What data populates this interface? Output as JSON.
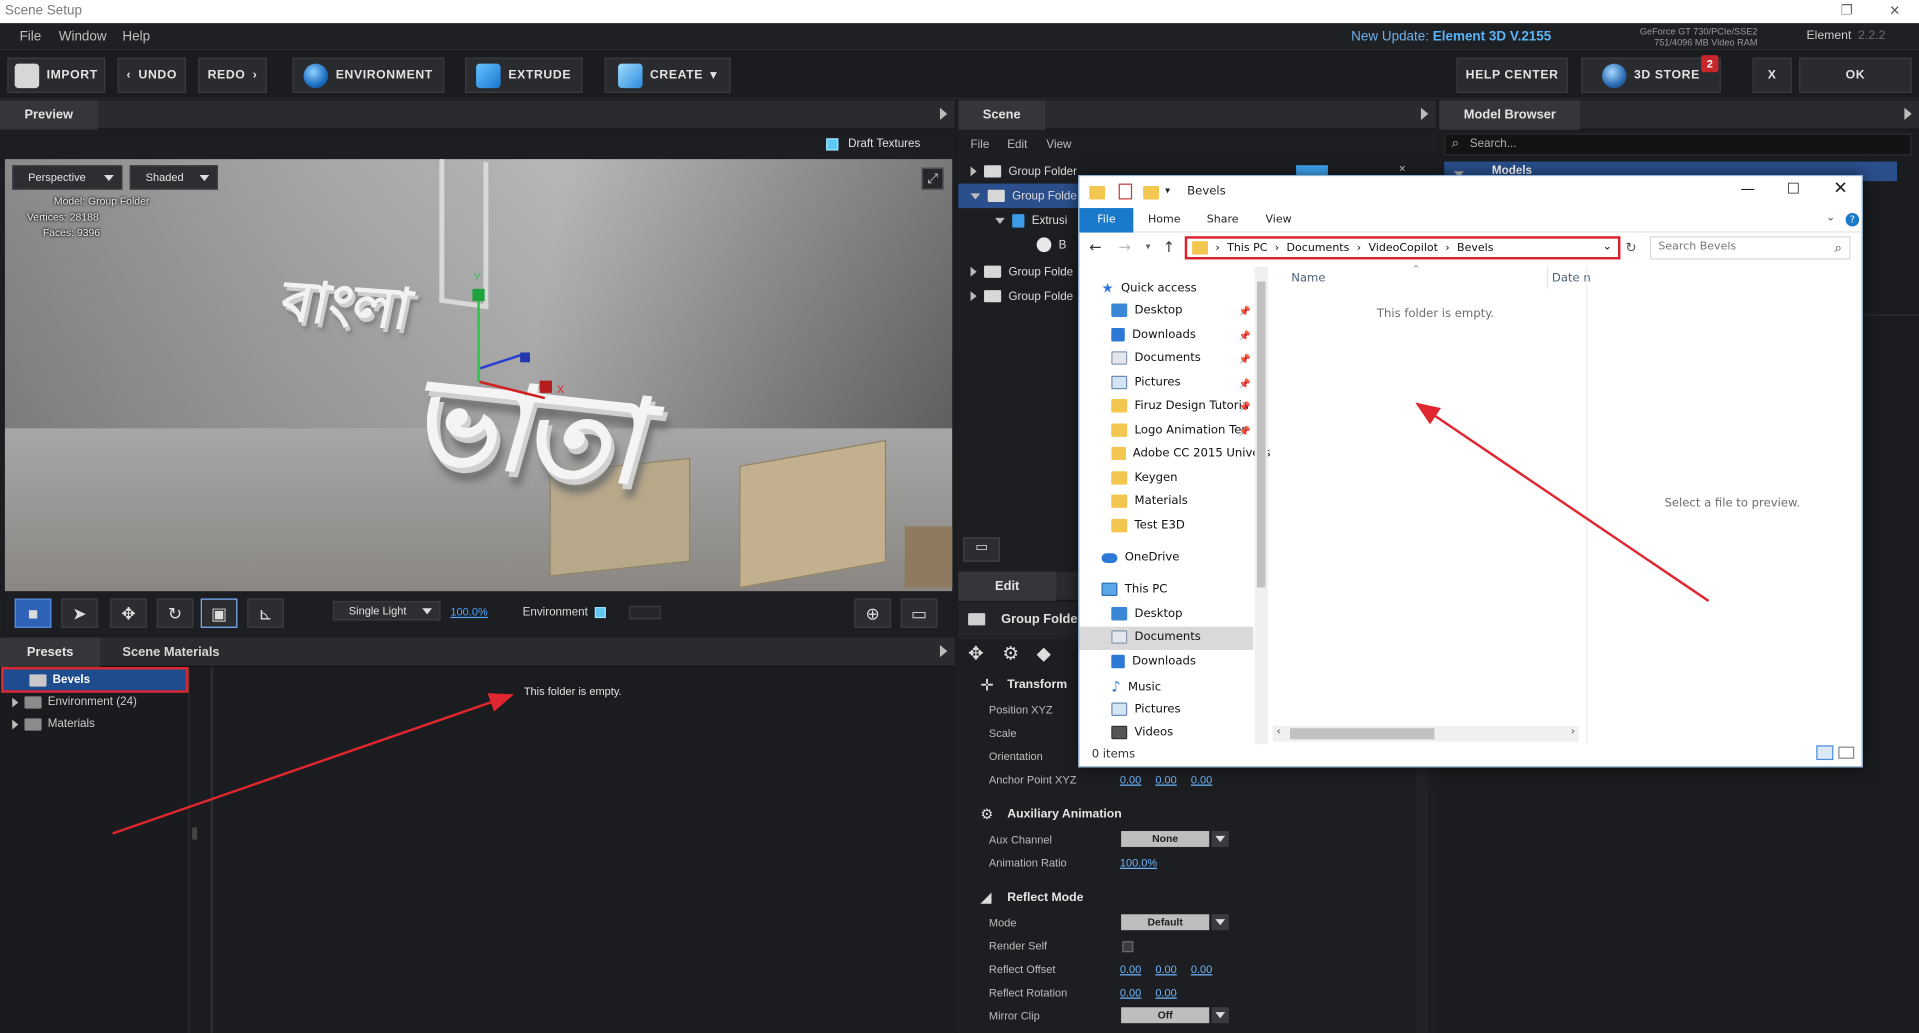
{
  "window": {
    "title": "Scene Setup"
  },
  "menu": [
    "File",
    "Window",
    "Help"
  ],
  "update": {
    "prefix": "New Update: ",
    "name": "Element 3D V.2155"
  },
  "gpu": {
    "line1": "GeForce GT 730/PCIe/SSE2",
    "line2": "751/4096 MB Video RAM"
  },
  "version": {
    "name": "Element",
    "num": "2.2.2"
  },
  "toolbar": {
    "import": "IMPORT",
    "undo": "UNDO",
    "redo": "REDO",
    "environment": "ENVIRONMENT",
    "extrude": "EXTRUDE",
    "create": "CREATE",
    "help_center": "HELP CENTER",
    "store": "3D STORE",
    "store_badge": "2",
    "close": "X",
    "ok": "OK"
  },
  "preview": {
    "title": "Preview",
    "draft_textures": "Draft Textures",
    "camera": "Perspective",
    "shading": "Shaded",
    "stats": {
      "model": "Model: Group Folder",
      "vertices": "Vertices: 28188",
      "faces": "Faces: 9396"
    },
    "word_small": "বাংলা",
    "word_big": "ভাতা",
    "axis_y": "Y",
    "axis_x": "X"
  },
  "viewport_bar": {
    "light": "Single Light",
    "zoom": "100.0%",
    "environment": "Environment"
  },
  "presets": {
    "tabs": [
      "Presets",
      "Scene Materials"
    ],
    "tree": [
      {
        "label": "Bevels",
        "selected": true
      },
      {
        "label": "Environment (24)"
      },
      {
        "label": "Materials"
      }
    ],
    "empty": "This folder is empty."
  },
  "scene": {
    "title": "Scene",
    "menu": [
      "File",
      "Edit",
      "View"
    ],
    "rows": [
      {
        "label": "Group Folder"
      },
      {
        "label": "Group Folde"
      },
      {
        "label": "Extrusi"
      },
      {
        "label": "B"
      },
      {
        "label": "Group Folde"
      },
      {
        "label": "Group Folde"
      }
    ],
    "edit_title": "Edit",
    "edit_object": "Group Folde",
    "transform": {
      "title": "Transform",
      "props": [
        "Position XYZ",
        "Scale",
        "Orientation",
        "Anchor Point XYZ"
      ],
      "anchor": [
        "0.00",
        "0.00",
        "0.00"
      ]
    },
    "aux": {
      "title": "Auxiliary Animation",
      "channel_label": "Aux Channel",
      "channel_value": "None",
      "ratio_label": "Animation Ratio",
      "ratio_value": "100.0%"
    },
    "reflect": {
      "title": "Reflect Mode",
      "mode_label": "Mode",
      "mode_value": "Default",
      "render_self": "Render Self",
      "offset_label": "Reflect Offset",
      "offset": [
        "0.00",
        "0.00",
        "0.00"
      ],
      "rotation_label": "Reflect Rotation",
      "rotation": [
        "0.00",
        "0.00"
      ],
      "mirror_label": "Mirror Clip",
      "mirror_value": "Off"
    }
  },
  "model_browser": {
    "title": "Model Browser",
    "search_placeholder": "Search...",
    "models": "Models"
  },
  "explorer": {
    "title": "Bevels",
    "ribbon": [
      "File",
      "Home",
      "Share",
      "View"
    ],
    "address": [
      "This PC",
      "Documents",
      "VideoCopilot",
      "Bevels"
    ],
    "search_placeholder": "Search Bevels",
    "nav": [
      {
        "label": "Quick access",
        "icon": "star-icon"
      },
      {
        "label": "Desktop",
        "icon": "desktop-icon",
        "pin": true
      },
      {
        "label": "Downloads",
        "icon": "download-icon",
        "pin": true
      },
      {
        "label": "Documents",
        "icon": "documents-icon",
        "pin": true
      },
      {
        "label": "Pictures",
        "icon": "pictures-icon",
        "pin": true
      },
      {
        "label": "Firuz Design Tutoria",
        "icon": "folder-icon",
        "pin": true
      },
      {
        "label": "Logo Animation Ter",
        "icon": "folder-icon",
        "pin": true
      },
      {
        "label": "Adobe CC 2015 Univers",
        "icon": "folder-icon"
      },
      {
        "label": "Keygen",
        "icon": "folder-icon"
      },
      {
        "label": "Materials",
        "icon": "folder-icon"
      },
      {
        "label": "Test E3D",
        "icon": "folder-icon"
      },
      {
        "label": "OneDrive",
        "icon": "cloud-icon"
      },
      {
        "label": "This PC",
        "icon": "computer-icon"
      },
      {
        "label": "Desktop",
        "icon": "desktop-icon"
      },
      {
        "label": "Documents",
        "icon": "documents-icon",
        "selected": true
      },
      {
        "label": "Downloads",
        "icon": "download-icon"
      },
      {
        "label": "Music",
        "icon": "music-icon"
      },
      {
        "label": "Pictures",
        "icon": "pictures-icon"
      },
      {
        "label": "Videos",
        "icon": "videos-icon"
      }
    ],
    "col_name": "Name",
    "col_date": "Date n",
    "empty": "This folder is empty.",
    "preview": "Select a file to preview.",
    "status": "0 items"
  },
  "colors": {
    "accent": "#1979ca",
    "annotation": "#e0262f",
    "link": "#4da6ff"
  }
}
